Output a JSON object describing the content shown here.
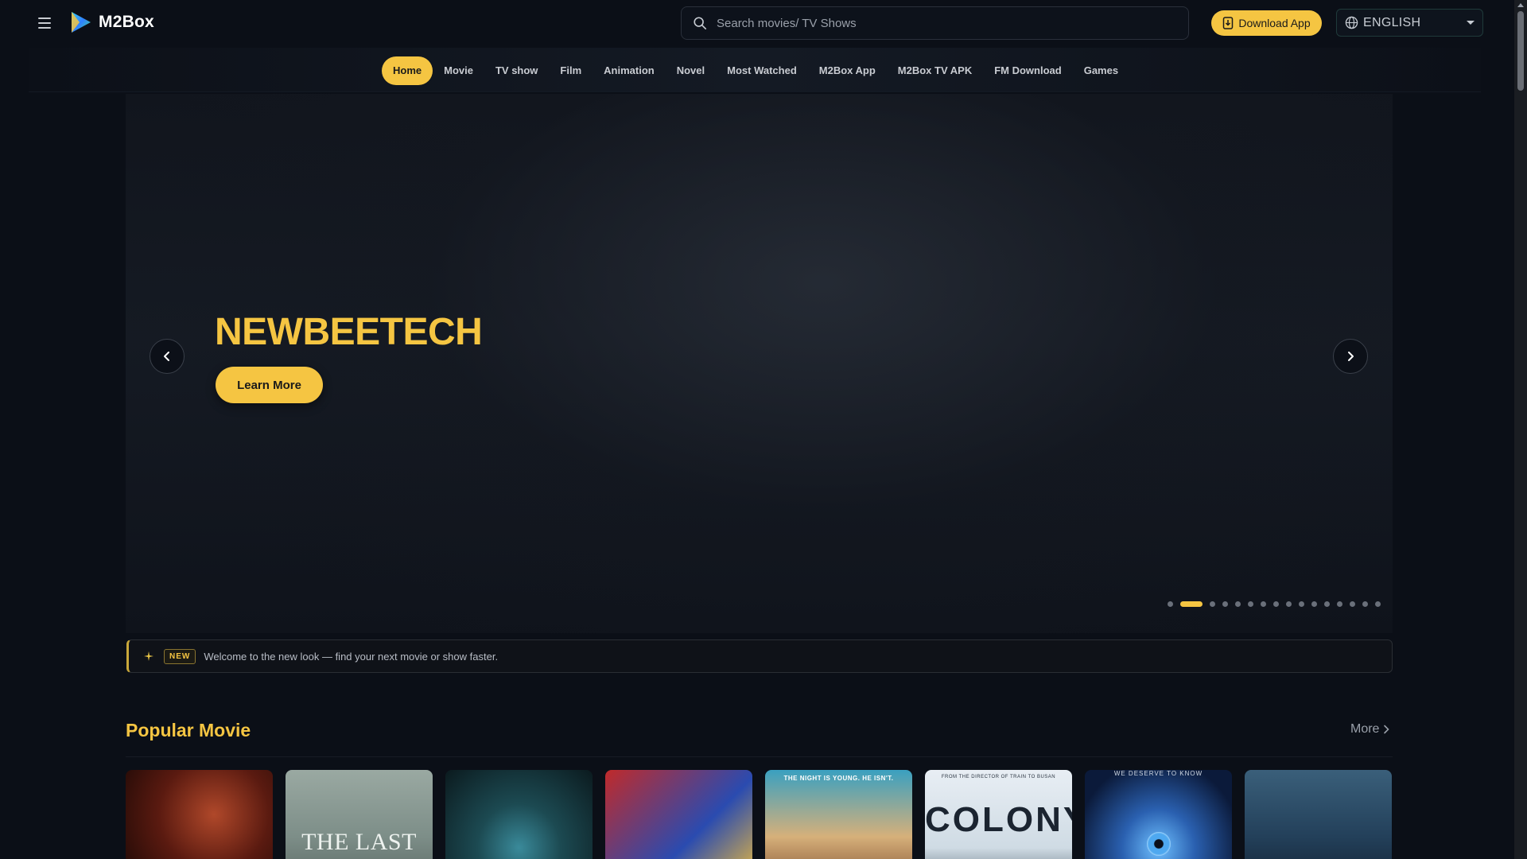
{
  "header": {
    "brand": "M2Box",
    "search": {
      "placeholder": "Search movies/ TV Shows",
      "value": ""
    },
    "download_label": "Download App",
    "language": "ENGLISH"
  },
  "nav": {
    "items": [
      {
        "label": "Home",
        "active": true
      },
      {
        "label": "Movie"
      },
      {
        "label": "TV show"
      },
      {
        "label": "Film"
      },
      {
        "label": "Animation"
      },
      {
        "label": "Novel"
      },
      {
        "label": "Most Watched"
      },
      {
        "label": "M2Box App"
      },
      {
        "label": "M2Box TV APK"
      },
      {
        "label": "FM Download"
      },
      {
        "label": "Games"
      }
    ]
  },
  "hero": {
    "title": "NEWBEETECH",
    "cta_label": "Learn More",
    "slide_count": 16,
    "active_slide": 2
  },
  "notice": {
    "badge": "NEW",
    "message": "Welcome to the new look — find your next movie or show faster."
  },
  "popular": {
    "title": "Popular Movie",
    "more_label": "More",
    "posters": [
      {
        "text": ""
      },
      {
        "text": "THE LAST HOUSE"
      },
      {
        "text": ""
      },
      {
        "text": ""
      },
      {
        "text": "THE NIGHT IS YOUNG. HE ISN'T."
      },
      {
        "text": "COLONY",
        "tag": "FROM THE DIRECTOR OF TRAIN TO BUSAN"
      },
      {
        "text": "WE DESERVE TO KNOW"
      },
      {
        "text": ""
      }
    ]
  },
  "colors": {
    "accent": "#f5c542",
    "background": "#0b0f17"
  },
  "icons": {
    "menu": "hamburger-icon",
    "search": "search-icon",
    "download": "phone-download-icon",
    "language": "globe-icon",
    "prev": "chevron-left-icon",
    "next": "chevron-right-icon",
    "notice": "sparkle-icon",
    "more": "chevron-right-icon"
  }
}
